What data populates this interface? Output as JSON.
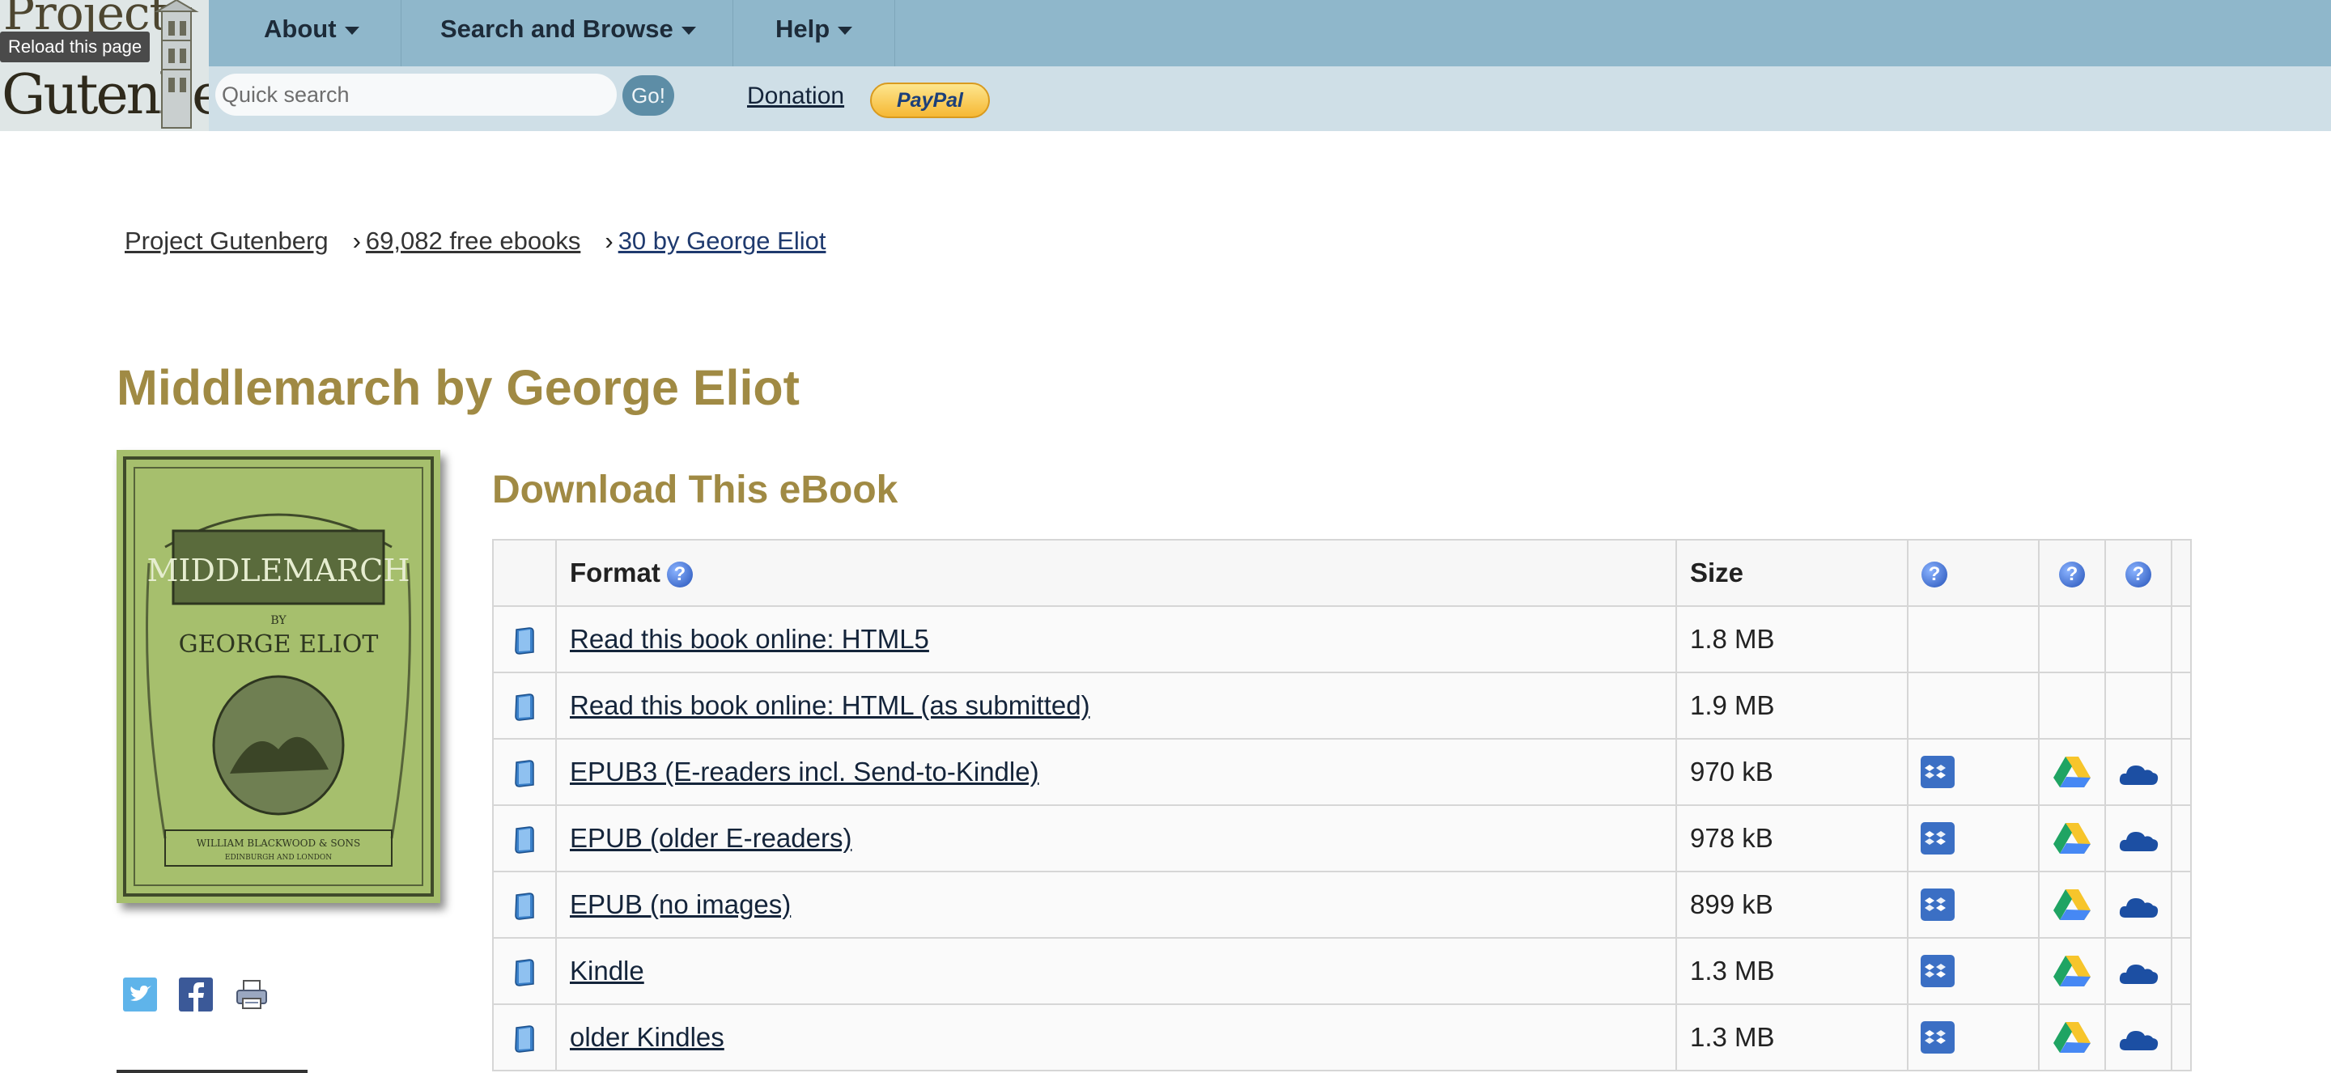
{
  "header": {
    "logo_top": "Project",
    "logo_bottom": "Gutenberg",
    "tooltip": "Reload this page",
    "nav": [
      {
        "label": "About"
      },
      {
        "label": "Search and Browse"
      },
      {
        "label": "Help"
      }
    ],
    "search": {
      "placeholder": "Quick search",
      "value": ""
    },
    "go_label": "Go!",
    "donation_label": "Donation",
    "paypal_label": "PayPal"
  },
  "breadcrumb": {
    "items": [
      "Project Gutenberg",
      "69,082 free ebooks",
      "30 by George Eliot"
    ],
    "separator": "›"
  },
  "book": {
    "title": "Middlemarch by George Eliot",
    "cover_title": "MIDDLEMARCH",
    "cover_by": "BY",
    "cover_author": "GEORGE ELIOT",
    "cover_publisher": "WILLIAM BLACKWOOD & SONS",
    "cover_place": "EDINBURGH AND LONDON"
  },
  "share_icons": [
    "twitter-icon",
    "facebook-icon",
    "print-icon"
  ],
  "download": {
    "title": "Download This eBook",
    "columns": {
      "format": "Format",
      "size": "Size"
    },
    "rows": [
      {
        "format": "Read this book online: HTML5",
        "size": "1.8 MB",
        "cloud": false
      },
      {
        "format": "Read this book online: HTML (as submitted)",
        "size": "1.9 MB",
        "cloud": false
      },
      {
        "format": "EPUB3 (E-readers incl. Send-to-Kindle)",
        "size": "970 kB",
        "cloud": true
      },
      {
        "format": "EPUB (older E-readers)",
        "size": "978 kB",
        "cloud": true
      },
      {
        "format": "EPUB (no images)",
        "size": "899 kB",
        "cloud": true
      },
      {
        "format": "Kindle",
        "size": "1.3 MB",
        "cloud": true
      },
      {
        "format": "older Kindles",
        "size": "1.3 MB",
        "cloud": true
      }
    ]
  },
  "colors": {
    "topbar": "#8fb7cb",
    "subbar": "#cfdfe7",
    "title": "#a08a44",
    "link": "#14243a"
  }
}
